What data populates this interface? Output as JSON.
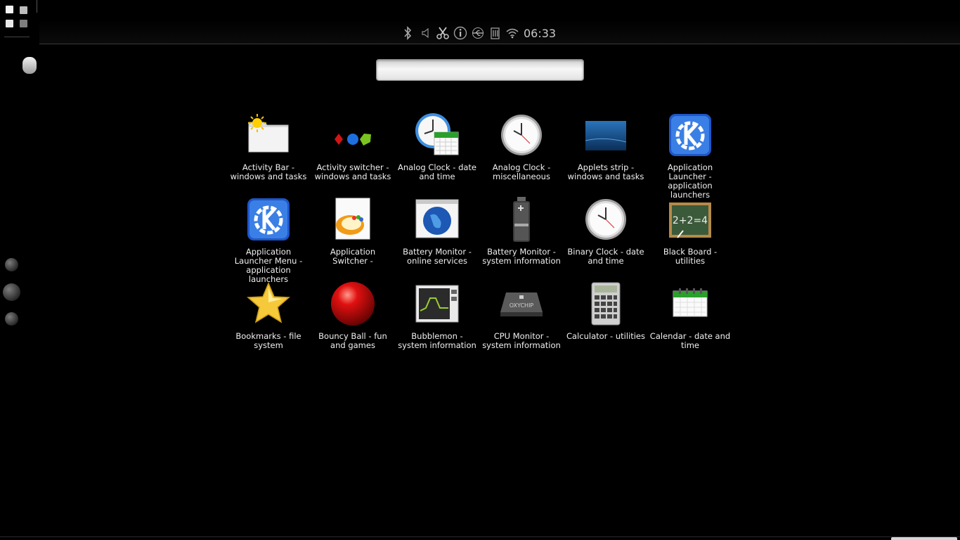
{
  "panel": {
    "clock": "06:33",
    "tray_icons": [
      "bluetooth-icon",
      "volume-icon",
      "scissors-icon",
      "info-icon",
      "usb-icon",
      "battery-icon",
      "wifi-icon"
    ]
  },
  "search": {
    "value": "",
    "placeholder": ""
  },
  "widgets": [
    {
      "label": "Activity Bar - windows and tasks",
      "icon": "activity-bar-icon"
    },
    {
      "label": "Activity switcher - windows and tasks",
      "icon": "activity-switcher-icon"
    },
    {
      "label": "Analog Clock - date and time",
      "icon": "analog-clock-calendar-icon"
    },
    {
      "label": "Analog Clock - miscellaneous",
      "icon": "analog-clock-icon"
    },
    {
      "label": "Applets strip - windows and tasks",
      "icon": "applets-strip-icon"
    },
    {
      "label": "Application Launcher - application launchers",
      "icon": "kde-launcher-icon"
    },
    {
      "label": "Application Launcher Menu - application launchers",
      "icon": "kde-launcher-icon"
    },
    {
      "label": "Application Switcher -",
      "icon": "app-switcher-icon"
    },
    {
      "label": "Battery Monitor - online services",
      "icon": "web-browser-icon"
    },
    {
      "label": "Battery Monitor - system information",
      "icon": "battery-icon"
    },
    {
      "label": "Binary Clock - date and time",
      "icon": "analog-clock-icon"
    },
    {
      "label": "Black Board - utilities",
      "icon": "blackboard-icon"
    },
    {
      "label": "Bookmarks - file system",
      "icon": "star-icon"
    },
    {
      "label": "Bouncy Ball - fun and games",
      "icon": "red-ball-icon"
    },
    {
      "label": "Bubblemon - system information",
      "icon": "system-monitor-icon"
    },
    {
      "label": "CPU Monitor - system information",
      "icon": "cpu-chip-icon"
    },
    {
      "label": "Calculator - utilities",
      "icon": "calculator-icon"
    },
    {
      "label": "Calendar - date and time",
      "icon": "calendar-icon"
    }
  ],
  "chip_text": "OXYCHIP",
  "blackboard_text": "2+2=4"
}
